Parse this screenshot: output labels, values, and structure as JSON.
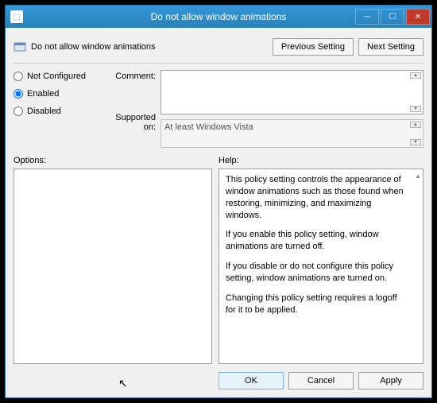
{
  "titlebar": {
    "title": "Do not allow window animations"
  },
  "policy": {
    "name": "Do not allow window animations"
  },
  "nav": {
    "previous": "Previous Setting",
    "next": "Next Setting"
  },
  "state": {
    "not_configured": "Not Configured",
    "enabled": "Enabled",
    "disabled": "Disabled",
    "selected": "enabled"
  },
  "labels": {
    "comment": "Comment:",
    "supported_on": "Supported on:",
    "options": "Options:",
    "help": "Help:"
  },
  "comment": "",
  "supported_on": "At least Windows Vista",
  "help": {
    "p1": "This policy setting controls the appearance of window animations such as those found when restoring, minimizing, and maximizing windows.",
    "p2": "If you enable this policy setting, window animations are turned off.",
    "p3": "If you disable or do not configure this policy setting, window animations are turned on.",
    "p4": "Changing this policy setting requires a logoff for it to be applied."
  },
  "footer": {
    "ok": "OK",
    "cancel": "Cancel",
    "apply": "Apply"
  }
}
